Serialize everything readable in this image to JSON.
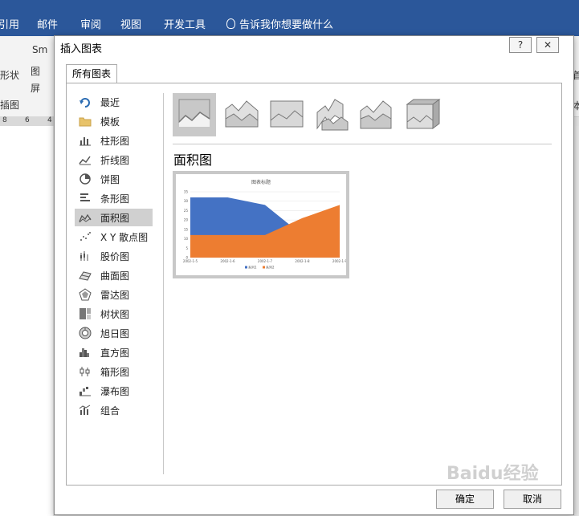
{
  "ribbon": {
    "tabs": [
      "引用",
      "邮件",
      "审阅",
      "视图",
      "开发工具"
    ],
    "tell_me": "告诉我你想要做什么",
    "fragments": [
      "形状",
      "图",
      "屏",
      "Sm",
      "插图",
      "本",
      "首"
    ],
    "ruler": [
      "8",
      "6",
      "4"
    ]
  },
  "dialog": {
    "title": "插入图表",
    "help": "?",
    "close": "✕",
    "tab_all": "所有图表",
    "section_title": "面积图",
    "ok_label": "确定",
    "cancel_label": "取消",
    "categories": [
      {
        "label": "最近",
        "icon": "recent-icon"
      },
      {
        "label": "模板",
        "icon": "folder-icon"
      },
      {
        "label": "柱形图",
        "icon": "column-chart-icon"
      },
      {
        "label": "折线图",
        "icon": "line-chart-icon"
      },
      {
        "label": "饼图",
        "icon": "pie-chart-icon"
      },
      {
        "label": "条形图",
        "icon": "bar-chart-icon"
      },
      {
        "label": "面积图",
        "icon": "area-chart-icon",
        "selected": true
      },
      {
        "label": "X Y 散点图",
        "icon": "scatter-chart-icon"
      },
      {
        "label": "股价图",
        "icon": "stock-chart-icon"
      },
      {
        "label": "曲面图",
        "icon": "surface-chart-icon"
      },
      {
        "label": "雷达图",
        "icon": "radar-chart-icon"
      },
      {
        "label": "树状图",
        "icon": "treemap-chart-icon"
      },
      {
        "label": "旭日图",
        "icon": "sunburst-chart-icon"
      },
      {
        "label": "直方图",
        "icon": "histogram-chart-icon"
      },
      {
        "label": "箱形图",
        "icon": "box-whisker-chart-icon"
      },
      {
        "label": "瀑布图",
        "icon": "waterfall-chart-icon"
      },
      {
        "label": "组合",
        "icon": "combo-chart-icon"
      }
    ]
  },
  "chart_data": {
    "type": "area",
    "title": "图表标题",
    "categories": [
      "2002-1-5",
      "2002-1-6",
      "2002-1-7",
      "2002-1-8",
      "2002-1-9"
    ],
    "series": [
      {
        "name": "系列1",
        "values": [
          32,
          32,
          28,
          12,
          15
        ],
        "color": "#4472c4"
      },
      {
        "name": "系列2",
        "values": [
          12,
          12,
          12,
          21,
          28
        ],
        "color": "#ed7d31"
      }
    ],
    "ylim": [
      0,
      35
    ],
    "yticks": [
      0,
      5,
      10,
      15,
      20,
      25,
      30,
      35
    ],
    "stacked": false
  },
  "watermark": "Baidu经验"
}
